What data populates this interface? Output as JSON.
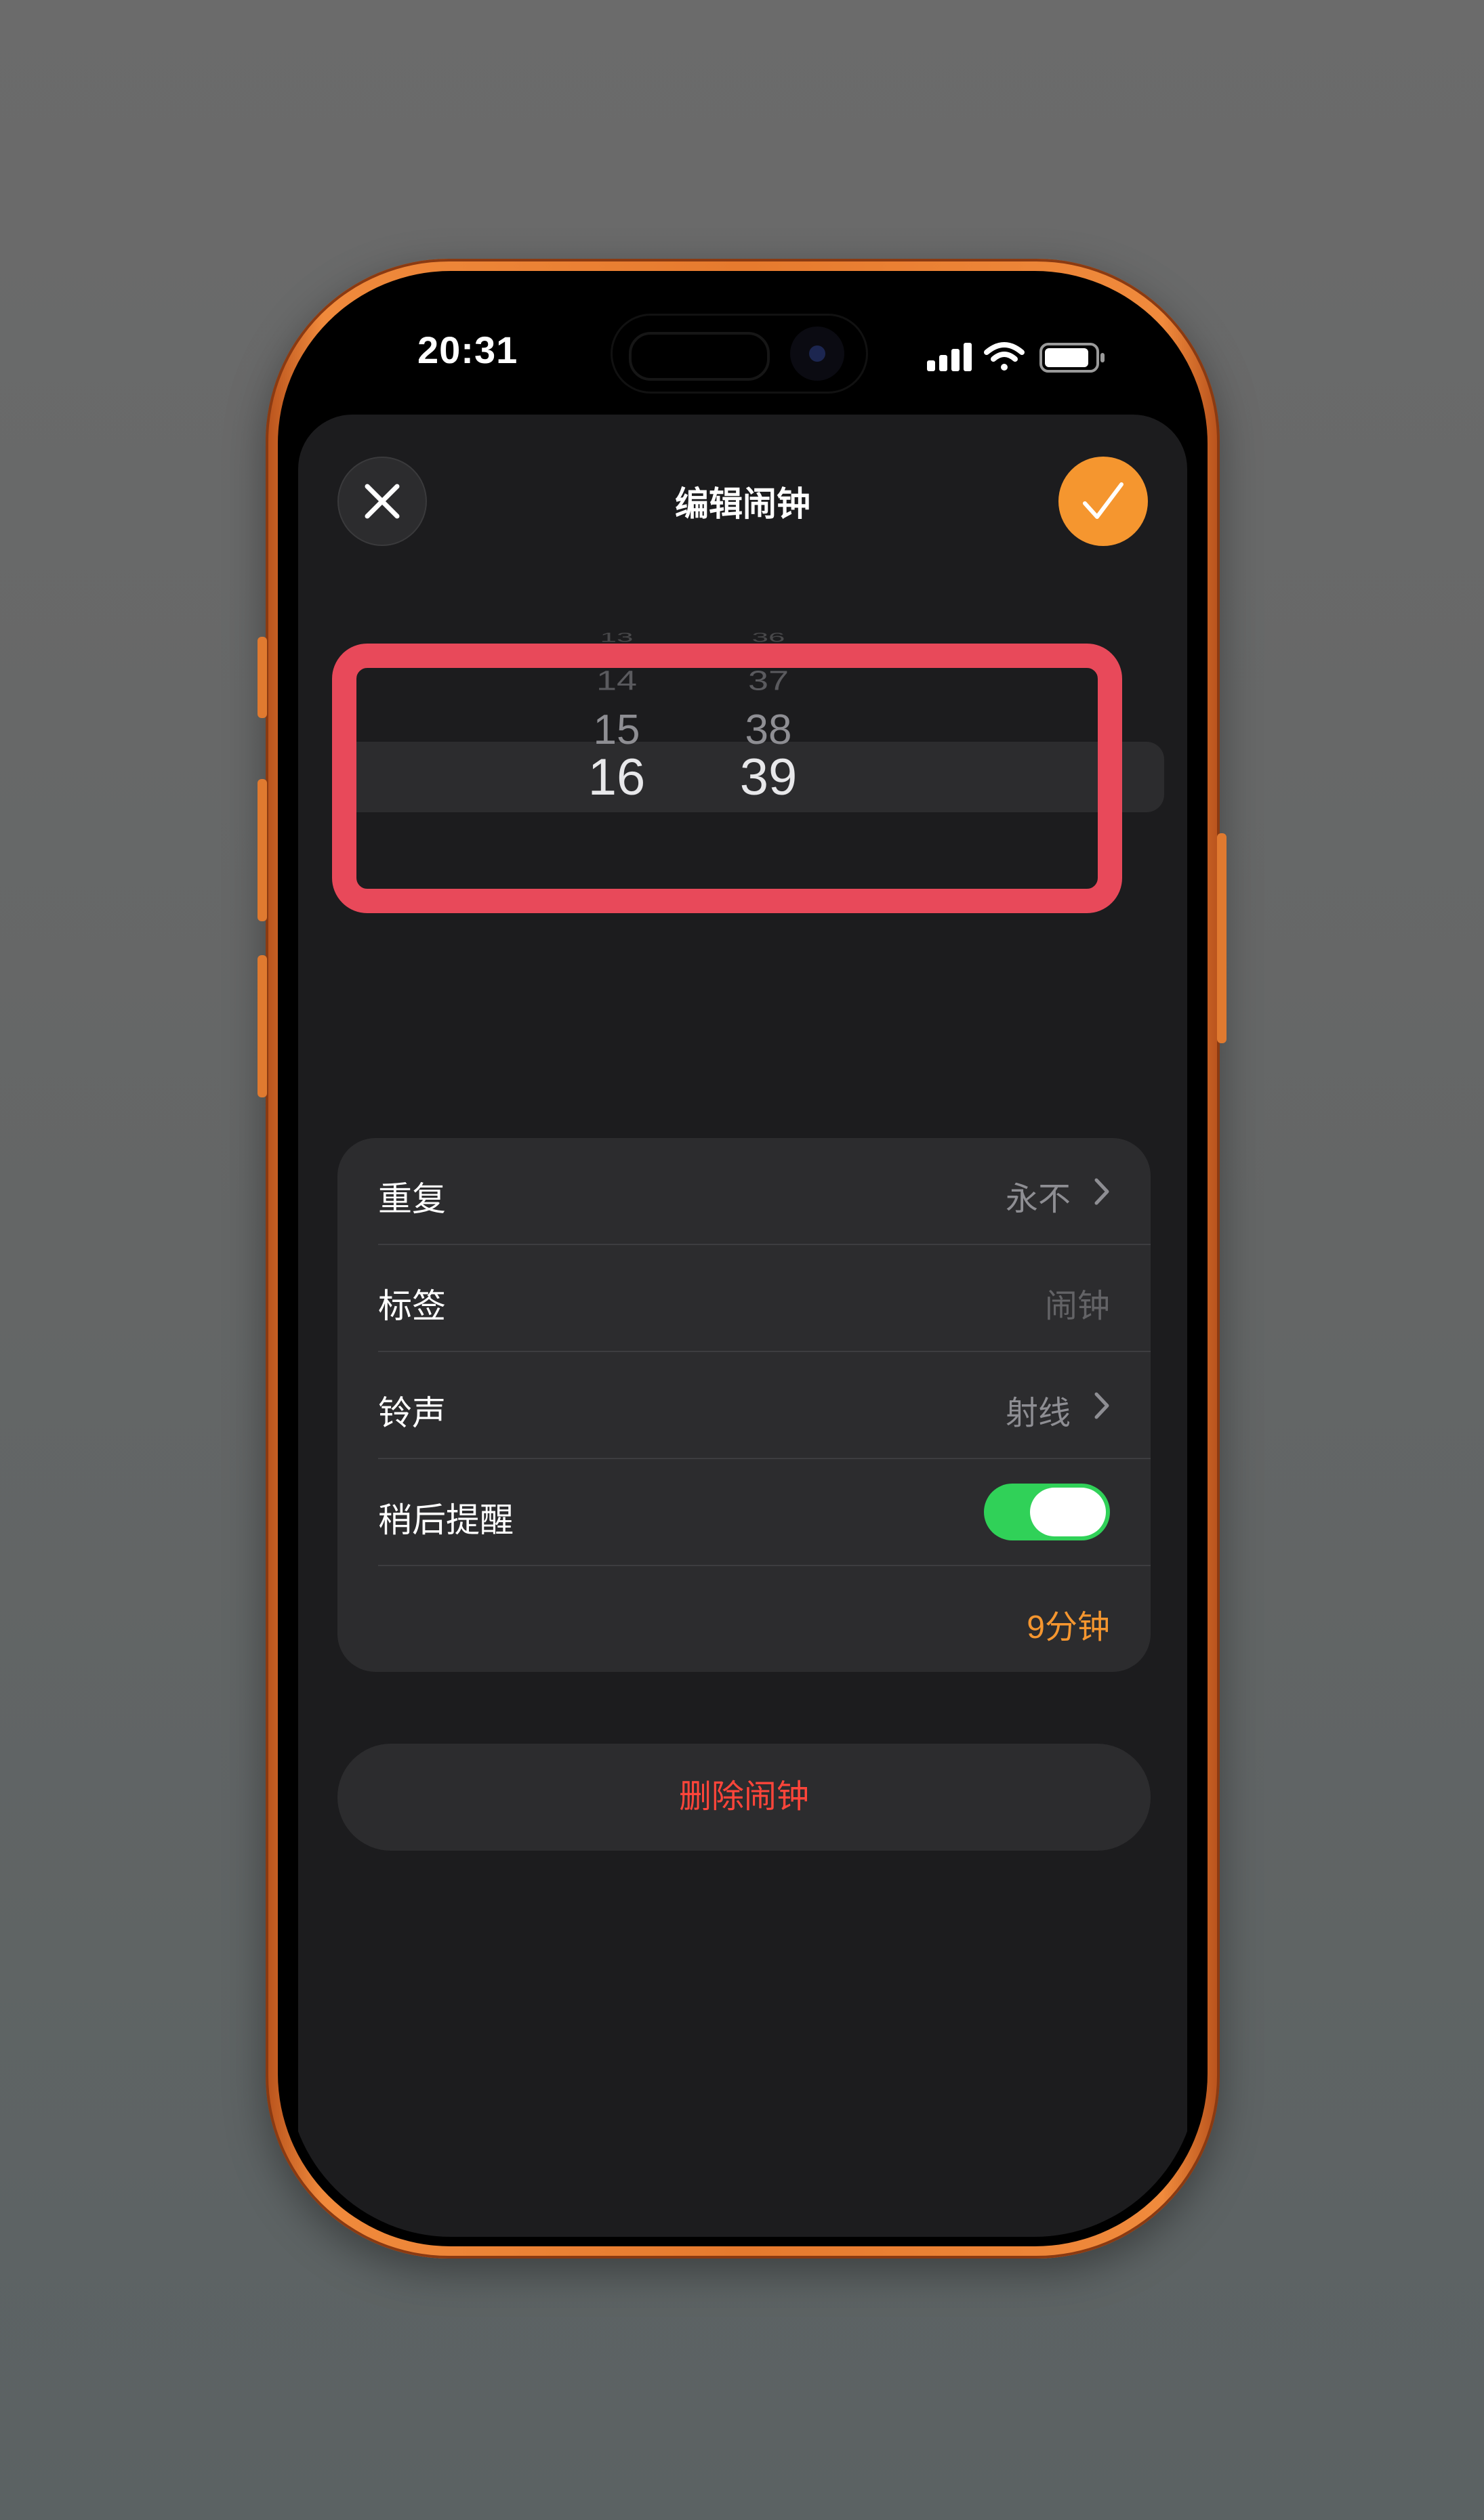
{
  "status_bar": {
    "time": "20:31",
    "icons": [
      "signal-icon",
      "wifi-icon",
      "battery-icon"
    ]
  },
  "header": {
    "title": "编辑闹钟",
    "cancel_icon": "close-icon",
    "done_icon": "checkmark-icon"
  },
  "picker": {
    "hours": {
      "above": [
        "13",
        "14",
        "15"
      ],
      "selected": "16"
    },
    "minutes": {
      "above": [
        "36",
        "37",
        "38"
      ],
      "selected": "39"
    }
  },
  "settings": {
    "repeat": {
      "label": "重复",
      "value": "永不"
    },
    "tag": {
      "label": "标签",
      "value": "闹钟"
    },
    "ringtone": {
      "label": "铃声",
      "value": "射线"
    },
    "snooze": {
      "label": "稍后提醒",
      "enabled": true
    },
    "snooze_duration": {
      "value": "9分钟"
    }
  },
  "delete": {
    "label": "删除闹钟"
  },
  "colors": {
    "accent": "#f5962f",
    "toggle_on": "#30d158",
    "destructive": "#ff453a",
    "highlight_box": "#e8495a",
    "phone_frame": "#e67a2e"
  }
}
